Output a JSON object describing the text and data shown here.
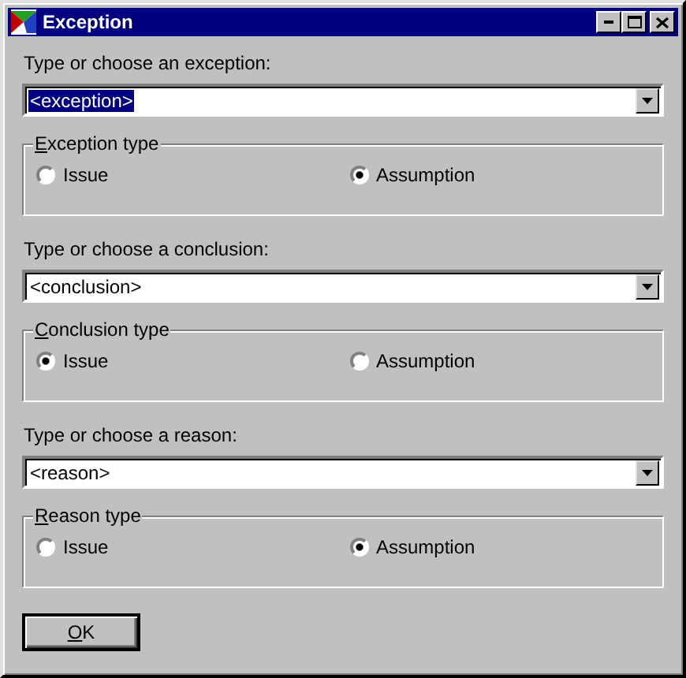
{
  "window": {
    "title": "Exception"
  },
  "sections": [
    {
      "prompt": "Type or choose an exception:",
      "value": "<exception>",
      "value_highlighted": true,
      "group": {
        "label": "Exception type",
        "mnemonic_underlined": true,
        "options": [
          {
            "label": "Issue",
            "selected": false
          },
          {
            "label": "Assumption",
            "selected": true
          }
        ]
      }
    },
    {
      "prompt": "Type or choose a conclusion:",
      "value": "<conclusion>",
      "value_highlighted": false,
      "group": {
        "label": "Conclusion type",
        "mnemonic_underlined": true,
        "options": [
          {
            "label": "Issue",
            "selected": true
          },
          {
            "label": "Assumption",
            "selected": false
          }
        ]
      }
    },
    {
      "prompt": "Type or choose a reason:",
      "value": "<reason>",
      "value_highlighted": false,
      "group": {
        "label": "Reason type",
        "mnemonic_underlined": true,
        "options": [
          {
            "label": "Issue",
            "selected": false
          },
          {
            "label": "Assumption",
            "selected": true
          }
        ]
      }
    }
  ],
  "buttons": [
    {
      "label": "OK",
      "mnemonic_underlined": true,
      "default": true
    }
  ]
}
